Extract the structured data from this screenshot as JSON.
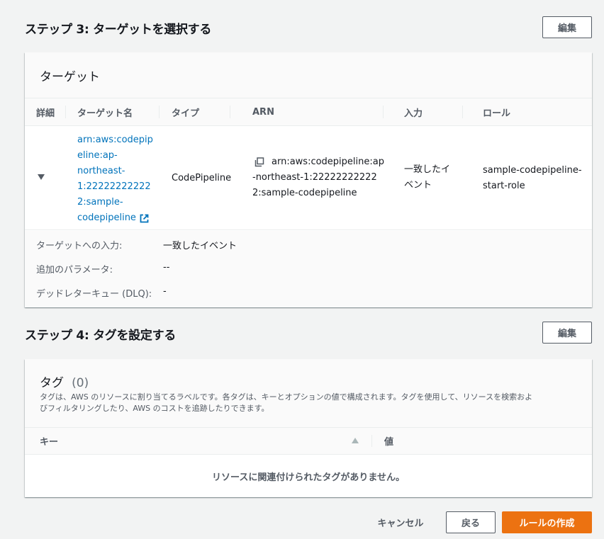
{
  "step3": {
    "title": "ステップ 3: ターゲットを選択する",
    "edit_label": "編集",
    "panel_title": "ターゲット",
    "columns": [
      "詳細",
      "ターゲット名",
      "タイプ",
      "ARN",
      "入力",
      "ロール"
    ],
    "row": {
      "target_name_lines": [
        "arn:aws:codepip",
        "eline:ap-",
        "northeast-",
        "1:22222222222",
        "2:sample-",
        "codepipeline"
      ],
      "type": "CodePipeline",
      "arn_lines": [
        "arn:aws:codepipeline:ap",
        "-northeast-1:22222222222",
        "2:sample-codepipeline"
      ],
      "input_lines": [
        "一致したイ",
        "ベント"
      ],
      "role_lines": [
        "sample-codepipeline-",
        "start-role"
      ]
    },
    "details": [
      {
        "label": "ターゲットへの入力:",
        "value": "一致したイベント"
      },
      {
        "label": "追加のパラメータ:",
        "value": "--"
      },
      {
        "label": "デッドレターキュー (DLQ):",
        "value": "-"
      }
    ]
  },
  "step4": {
    "title": "ステップ 4: タグを設定する",
    "edit_label": "編集",
    "panel_title": "タグ",
    "count": "(0)",
    "description_lines": [
      "タグは、AWS のリソースに割り当てるラベルです。各タグは、キーとオプションの値で構成されます。タグを使用して、リソースを検索およ",
      "びフィルタリングしたり、AWS のコストを追跡したりできます。"
    ],
    "columns": [
      "キー",
      "値"
    ],
    "empty_message": "リソースに関連付けられたタグがありません。"
  },
  "footer": {
    "cancel_label": "キャンセル",
    "back_label": "戻る",
    "create_label": "ルールの作成"
  },
  "colors": {
    "link": "#0073bb",
    "primary": "#ec7211",
    "background": "#f2f3f3"
  }
}
